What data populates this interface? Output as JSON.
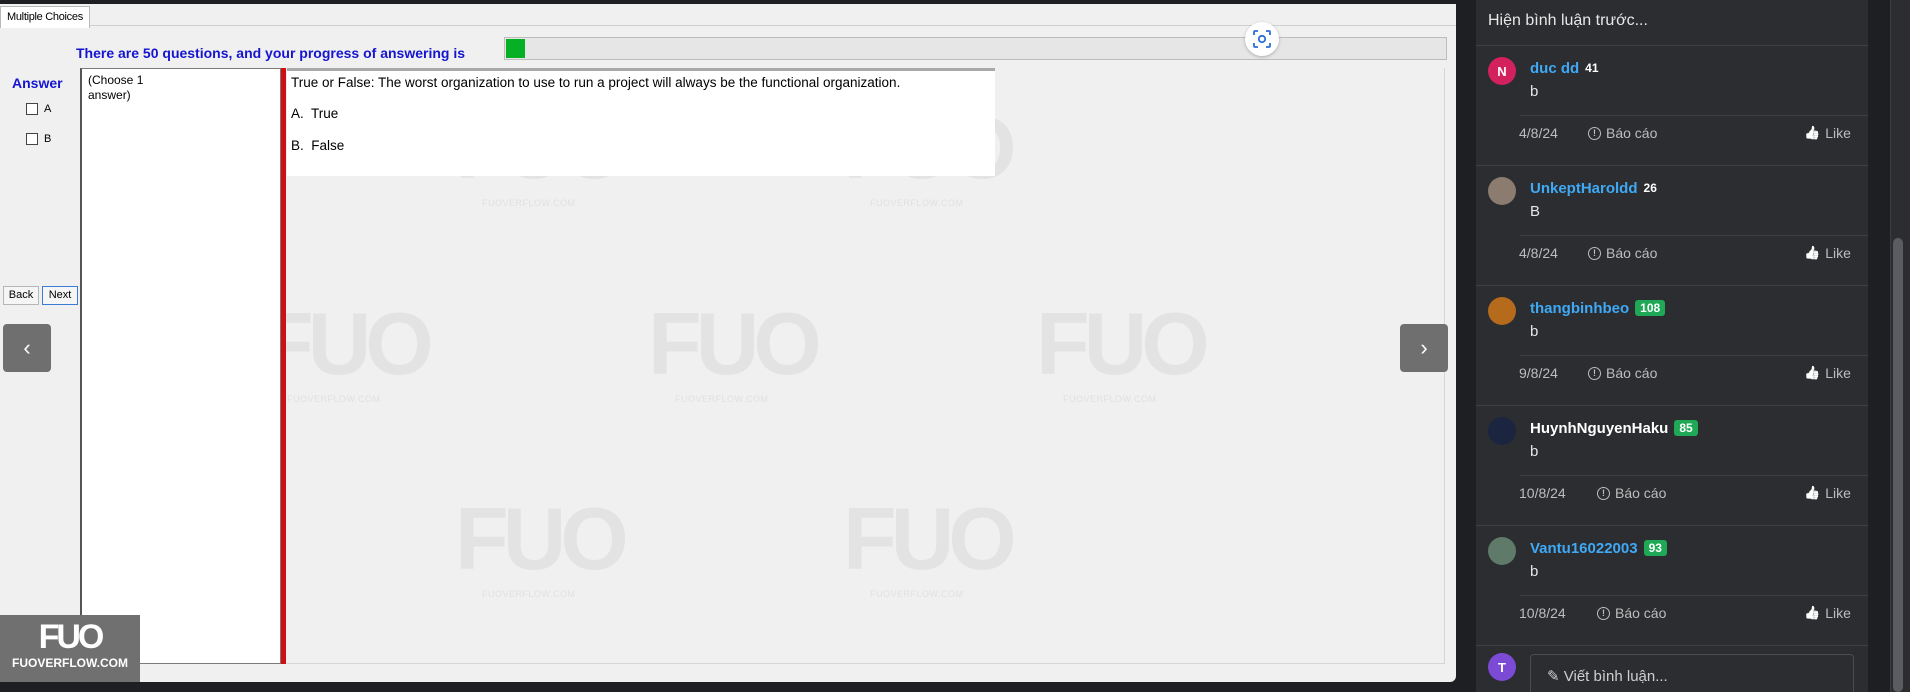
{
  "exam": {
    "tab_label": "Multiple Choices",
    "progress_label": "There are 50 questions, and your progress of answering is",
    "progress_fraction": 0.02,
    "answer_label": "Answer",
    "answer_options": [
      "A",
      "B"
    ],
    "choose_hint": "(Choose 1 answer)",
    "question": "True or False: The worst organization to use to run a project will always be the functional organization.",
    "options": [
      {
        "letter": "A.",
        "text": "True"
      },
      {
        "letter": "B.",
        "text": "False"
      }
    ],
    "back_label": "Back",
    "next_label": "Next",
    "prev_arrow": "‹",
    "next_arrow": "›"
  },
  "watermark": {
    "main": "FUO",
    "sub": "FUOVERFLOW.COM"
  },
  "logo": {
    "main": "FUO",
    "sub": "FUOVERFLOW.COM"
  },
  "comments_panel": {
    "show_previous": "Hiện bình luận trước...",
    "report_label": "Báo cáo",
    "like_label": "Like",
    "write_placeholder": "Viết bình luận...",
    "comments": [
      {
        "avatar_letter": "N",
        "avatar_color": "#d3215e",
        "name": "duc dd",
        "name_color": "blue",
        "badge": "41",
        "badge_style": "plain",
        "body": "b",
        "date": "4/8/24"
      },
      {
        "avatar_letter": "",
        "avatar_color": "#8c7c70",
        "name": "UnkeptHaroldd",
        "name_color": "blue",
        "badge": "26",
        "badge_style": "plain",
        "body": "B",
        "date": "4/8/24"
      },
      {
        "avatar_letter": "",
        "avatar_color": "#b56a1c",
        "name": "thangbinhbeo",
        "name_color": "blue",
        "badge": "108",
        "badge_style": "green",
        "body": "b",
        "date": "9/8/24"
      },
      {
        "avatar_letter": "",
        "avatar_color": "#1c2540",
        "name": "HuynhNguyenHaku",
        "name_color": "white",
        "badge": "85",
        "badge_style": "green",
        "body": "b",
        "date": "10/8/24"
      },
      {
        "avatar_letter": "",
        "avatar_color": "#5f7a68",
        "name": "Vantu16022003",
        "name_color": "blue",
        "badge": "93",
        "badge_style": "green",
        "body": "b",
        "date": "10/8/24"
      }
    ],
    "current_user_letter": "T",
    "current_user_color": "#7b4bd6"
  }
}
